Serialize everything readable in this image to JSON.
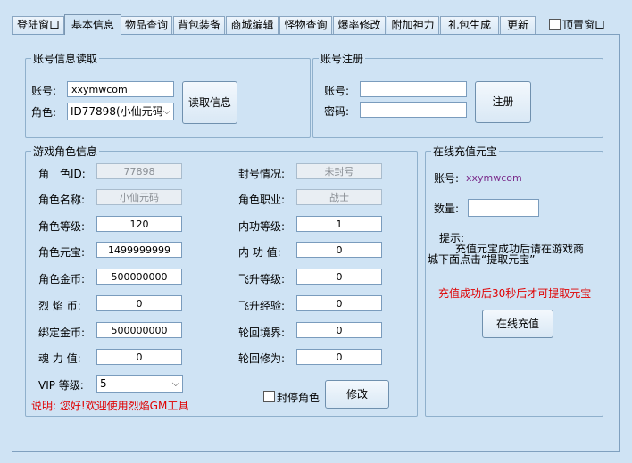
{
  "tabs": [
    "登陆窗口",
    "基本信息",
    "物品查询",
    "背包装备",
    "商城编辑",
    "怪物查询",
    "爆率修改",
    "附加神力",
    "礼包生成",
    "更新"
  ],
  "topmost": {
    "label": "顶置窗口",
    "checked": false
  },
  "account_read": {
    "title": "账号信息读取",
    "account_label": "账号:",
    "account_value": "xxymwcom",
    "role_label": "角色:",
    "role_value": "ID77898(小仙元码",
    "read_button": "读取信息"
  },
  "register": {
    "title": "账号注册",
    "account_label": "账号:",
    "password_label": "密码:",
    "account_value": "",
    "password_value": "",
    "register_button": "注册"
  },
  "role_info": {
    "title": "游戏角色信息",
    "left": [
      {
        "label": "角　色ID:",
        "value": "77898",
        "readonly": true
      },
      {
        "label": "角色名称:",
        "value": "小仙元码",
        "readonly": true
      },
      {
        "label": "角色等级:",
        "value": "120",
        "readonly": false
      },
      {
        "label": "角色元宝:",
        "value": "1499999999",
        "readonly": false
      },
      {
        "label": "角色金币:",
        "value": "500000000",
        "readonly": false
      },
      {
        "label": "烈 焰 币:",
        "value": "0",
        "readonly": false
      },
      {
        "label": "绑定金币:",
        "value": "500000000",
        "readonly": false
      },
      {
        "label": "魂 力 值:",
        "value": "0",
        "readonly": false
      }
    ],
    "right": [
      {
        "label": "封号情况:",
        "value": "未封号",
        "readonly": true
      },
      {
        "label": "角色职业:",
        "value": "战士",
        "readonly": true
      },
      {
        "label": "内功等级:",
        "value": "1",
        "readonly": false
      },
      {
        "label": "内 功 值:",
        "value": "0",
        "readonly": false
      },
      {
        "label": "飞升等级:",
        "value": "0",
        "readonly": false
      },
      {
        "label": "飞升经验:",
        "value": "0",
        "readonly": false
      },
      {
        "label": "轮回境界:",
        "value": "0",
        "readonly": false
      },
      {
        "label": "轮回修为:",
        "value": "0",
        "readonly": false
      }
    ],
    "vip_label": "VIP 等级:",
    "vip_value": "5",
    "ban_label": "封停角色",
    "modify_button": "修改",
    "note": "说明: 您好!欢迎使用烈焰GM工具"
  },
  "recharge": {
    "title": "在线充值元宝",
    "account_label": "账号:",
    "account_value": "xxymwcom",
    "amount_label": "数量:",
    "amount_value": "",
    "hint_title": "提示:",
    "hint_line1": "充值元宝成功后请在游戏商",
    "hint_line2": "城下面点击“提取元宝”",
    "warning": "充值成功后30秒后才可提取元宝",
    "recharge_button": "在线充值"
  },
  "colors": {
    "background": "#cfe3f4",
    "warning": "#e00000",
    "account_text": "#7a2a8a"
  }
}
